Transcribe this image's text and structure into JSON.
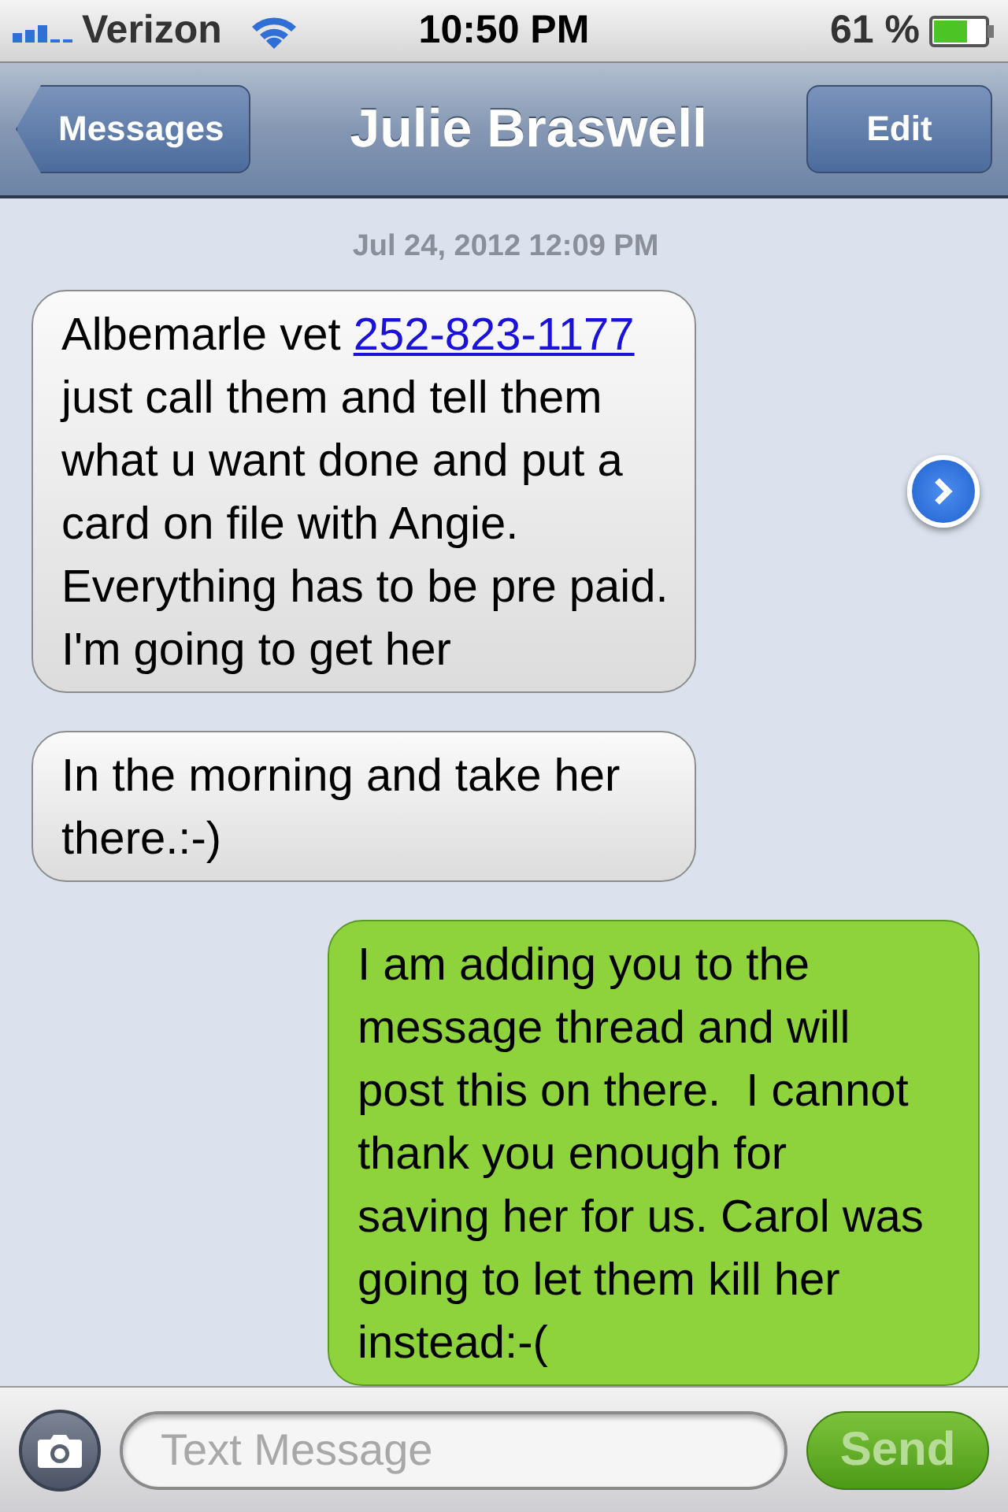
{
  "status_bar": {
    "carrier": "Verizon",
    "time": "10:50 PM",
    "battery": "61 %"
  },
  "nav": {
    "back": "Messages",
    "title": "Julie Braswell",
    "action": "Edit"
  },
  "timestamp": "Jul 24, 2012 12:09 PM",
  "messages": [
    {
      "kind": "incoming",
      "detail_button": true,
      "parts": [
        {
          "kind": "plain",
          "text": "Albemarle vet "
        },
        {
          "kind": "link",
          "text": "252-823-1177"
        },
        {
          "kind": "plain",
          "text": " just call them and tell them what u want done and put a card on file with Angie. Everything has to be pre paid. I'm going to get her"
        }
      ]
    },
    {
      "kind": "incoming",
      "detail_button": false,
      "parts": [
        {
          "kind": "plain",
          "text": "In the morning and take her there.:-)"
        }
      ]
    },
    {
      "kind": "outgoing",
      "detail_button": false,
      "parts": [
        {
          "kind": "plain",
          "text": "I am adding you to the message thread and will post this on there.  I cannot thank you enough for saving her for us. Carol was going to let them kill her instead:-("
        }
      ]
    }
  ],
  "compose": {
    "placeholder": "Text Message",
    "send": {
      "label": "Send",
      "disabled": true
    }
  }
}
